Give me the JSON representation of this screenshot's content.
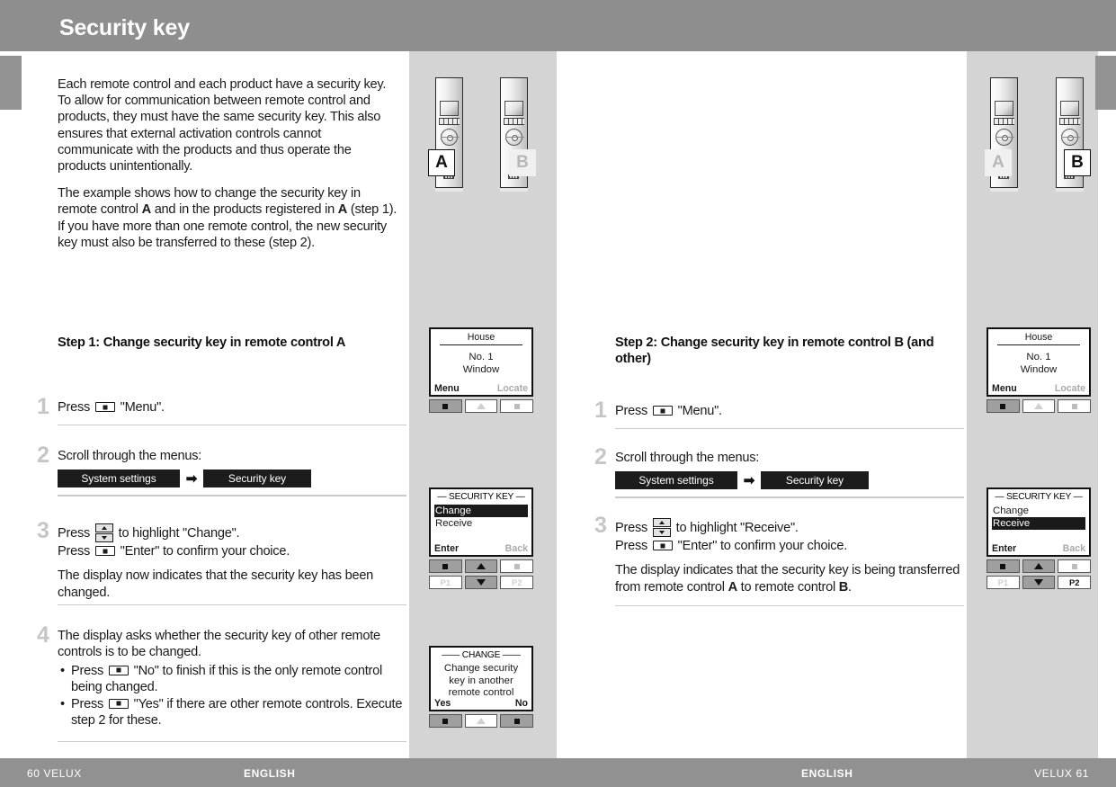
{
  "banner": {
    "title": "Security key"
  },
  "intro": {
    "p1": "Each remote control and each product have a security key. To allow for communication between remote control and products, they must have the same security key. This also ensures that external activation controls cannot communicate with the products and thus operate the products unintentionally.",
    "p2_a": "The example shows how to change the security key in remote control ",
    "p2_b": "A",
    "p2_c": " and in the products registered in ",
    "p2_d": "A",
    "p2_e": " (step 1). If you have more than one remote control, the new security key must also be transferred to these (step 2)."
  },
  "left_page": {
    "step_heading": "Step 1: Change security key in remote control A",
    "steps": [
      {
        "num": "1",
        "text_a": "Press ",
        "text_b": " \"Menu\"."
      },
      {
        "num": "2",
        "text_a": "Scroll through the menus:",
        "chip1": "System settings",
        "arrow": "➡",
        "chip2": "Security key"
      },
      {
        "num": "3",
        "line1_a": "Press ",
        "line1_b": " to highlight \"Change\".",
        "line2_a": "Press ",
        "line2_b": " \"Enter\" to confirm your choice.",
        "note": "The display now indicates that the security key has been changed."
      },
      {
        "num": "4",
        "text": "The display asks whether the security key of other remote controls is to be changed.",
        "bullet1_a": "Press ",
        "bullet1_b": " \"No\" to finish if this is the only remote control being changed.",
        "bullet2_a": "Press ",
        "bullet2_b": " \"Yes\" if there are other remote controls. Execute step 2 for these."
      }
    ],
    "lcd_house": {
      "title": "House",
      "line1": "No. 1",
      "line2": "Window",
      "left_label": "Menu",
      "right_label": "Locate",
      "buttons": [
        "select",
        "up",
        "select"
      ]
    },
    "lcd_security": {
      "title": "— SECURITY KEY —",
      "items": [
        "Change",
        "Receive"
      ],
      "selected": 0,
      "left_label": "Enter",
      "right_label": "Back",
      "p1": "P1",
      "p2": "P2"
    },
    "lcd_change": {
      "title": "—— CHANGE ——",
      "line1": "Change security",
      "line2": "key in another",
      "line3": "remote control",
      "left_label": "Yes",
      "right_label": "No"
    },
    "remotes": [
      {
        "tag": "A",
        "active": true
      },
      {
        "tag": "B",
        "active": false
      }
    ]
  },
  "right_page": {
    "step_heading": "Step 2: Change security key in remote control B (and other)",
    "steps": [
      {
        "num": "1",
        "text_a": "Press ",
        "text_b": " \"Menu\"."
      },
      {
        "num": "2",
        "text_a": "Scroll through the menus:",
        "chip1": "System settings",
        "arrow": "➡",
        "chip2": "Security key"
      },
      {
        "num": "3",
        "line1_a": "Press ",
        "line1_b": " to highlight \"Receive\".",
        "line2_a": "Press ",
        "line2_b": " \"Enter\" to confirm your choice.",
        "note_a": "The display indicates that the security key is being transferred from remote control ",
        "note_b": "A",
        "note_c": " to remote control ",
        "note_d": "B",
        "note_e": "."
      }
    ],
    "lcd_house": {
      "title": "House",
      "line1": "No. 1",
      "line2": "Window",
      "left_label": "Menu",
      "right_label": "Locate"
    },
    "lcd_security": {
      "title": "— SECURITY KEY —",
      "items": [
        "Change",
        "Receive"
      ],
      "selected": 1,
      "left_label": "Enter",
      "right_label": "Back",
      "p1": "P1",
      "p2": "P2"
    },
    "remotes": [
      {
        "tag": "A",
        "active": false
      },
      {
        "tag": "B",
        "active": true
      }
    ]
  },
  "footer": {
    "page_left": "60  VELUX",
    "lang_left": "ENGLISH",
    "lang_right": "ENGLISH",
    "page_right": "VELUX  61"
  },
  "colors": {
    "banner_bg": "#8e8e8e",
    "gray_panel": "#d4d4d4",
    "footer_bg": "#919191",
    "chip_bg": "#1c1c1c",
    "step_number": "#c6c6c6"
  }
}
